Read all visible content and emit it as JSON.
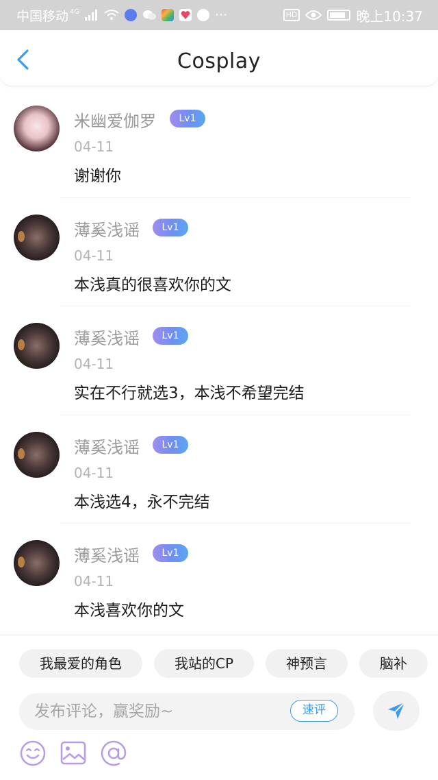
{
  "status_bar": {
    "carrier": "中国移动",
    "network": "4G",
    "time": "晚上10:37",
    "hd_label": "HD"
  },
  "header": {
    "title": "Cosplay"
  },
  "comments": [
    {
      "username": "米幽爱伽罗",
      "level": "Lv1",
      "date": "04-11",
      "text": "谢谢你"
    },
    {
      "username": "薄奚浅谣",
      "level": "Lv1",
      "date": "04-11",
      "text": "本浅真的很喜欢你的文"
    },
    {
      "username": "薄奚浅谣",
      "level": "Lv1",
      "date": "04-11",
      "text": "实在不行就选3，本浅不希望完结"
    },
    {
      "username": "薄奚浅谣",
      "level": "Lv1",
      "date": "04-11",
      "text": "本浅选4，永不完结"
    },
    {
      "username": "薄奚浅谣",
      "level": "Lv1",
      "date": "04-11",
      "text": "本浅喜欢你的文"
    }
  ],
  "quick_tags": [
    "我最爱的角色",
    "我站的CP",
    "神预言",
    "脑补"
  ],
  "composer": {
    "placeholder": "发布评论，赢奖励~",
    "quick_review_label": "速评"
  },
  "colors": {
    "accent": "#3a9cf0",
    "level_badge_start": "#a18cf0",
    "level_badge_end": "#5aa7ef",
    "toolbar_icon": "#b89be8"
  }
}
